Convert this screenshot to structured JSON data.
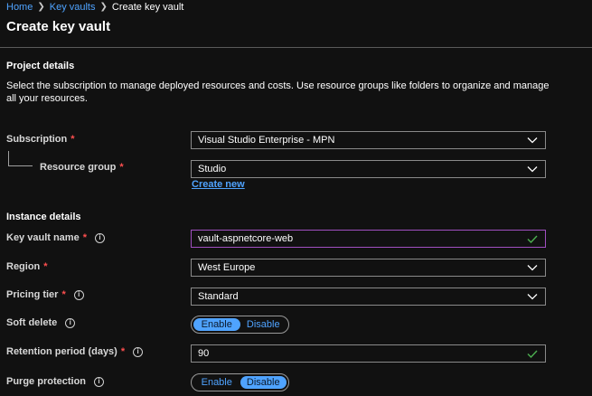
{
  "breadcrumb": {
    "home": "Home",
    "key_vaults": "Key vaults",
    "current": "Create key vault"
  },
  "page_title": "Create key vault",
  "project_details": {
    "heading": "Project details",
    "description": "Select the subscription to manage deployed resources and costs. Use resource groups like folders to organize and manage all your resources."
  },
  "subscription": {
    "label": "Subscription",
    "required": "*",
    "value": "Visual Studio Enterprise - MPN"
  },
  "resource_group": {
    "label": "Resource group",
    "required": "*",
    "value": "Studio",
    "create_new": "Create new"
  },
  "instance_details": {
    "heading": "Instance details"
  },
  "key_vault_name": {
    "label": "Key vault name",
    "required": "*",
    "value": "vault-aspnetcore-web"
  },
  "region": {
    "label": "Region",
    "required": "*",
    "value": "West Europe"
  },
  "pricing_tier": {
    "label": "Pricing tier",
    "required": "*",
    "value": "Standard"
  },
  "soft_delete": {
    "label": "Soft delete",
    "enable": "Enable",
    "disable": "Disable",
    "selected": "Enable"
  },
  "retention_period": {
    "label": "Retention period (days)",
    "required": "*",
    "value": "90"
  },
  "purge_protection": {
    "label": "Purge protection",
    "enable": "Enable",
    "disable": "Disable",
    "selected": "Disable"
  },
  "colors": {
    "accent": "#4fa3ff",
    "required": "#ff4f4f",
    "valid_check": "#4caf50",
    "focus_border": "#a04fc0",
    "background": "#111111"
  },
  "icons": {
    "info": "info-icon",
    "dropdown": "chevron-down-icon",
    "valid": "checkmark-icon",
    "breadcrumb_separator": "chevron-right-icon"
  }
}
